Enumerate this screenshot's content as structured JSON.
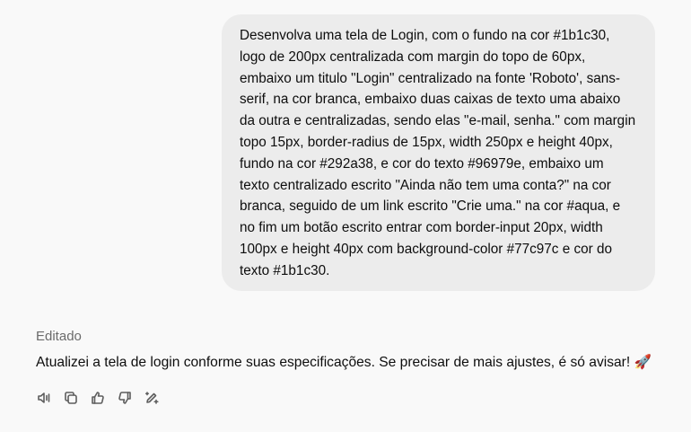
{
  "user_message": {
    "text": "Desenvolva uma tela de Login, com o fundo na cor #1b1c30, logo de 200px centralizada com margin do topo de 60px, embaixo um titulo \"Login\" centralizado na fonte 'Roboto', sans-serif, na cor branca, embaixo duas caixas de texto uma abaixo da outra e centralizadas, sendo elas \"e-mail, senha.\" com margin topo 15px, border-radius de 15px, width 250px e height 40px, fundo na cor #292a38, e cor do texto #96979e, embaixo um texto centralizado escrito \"Ainda não tem uma conta?\" na cor branca, seguido de um link escrito \"Crie uma.\" na cor #aqua, e no fim um botão escrito entrar com border-input 20px, width 100px e height 40px com background-color #77c97c e cor do texto #1b1c30."
  },
  "assistant_message": {
    "edited_label": "Editado",
    "text": "Atualizei a tela de login conforme suas especificações. Se precisar de mais ajustes, é só avisar! 🚀"
  },
  "actions": {
    "icons": [
      "speaker-icon",
      "copy-icon",
      "thumbs-up-icon",
      "thumbs-down-icon",
      "edit-sparkle-icon"
    ],
    "icon_color": "#5d5d5d"
  },
  "colors": {
    "background": "#f9f9f9",
    "bubble": "#ececec",
    "text": "#0d0d0d",
    "muted": "#6b6b6b"
  }
}
